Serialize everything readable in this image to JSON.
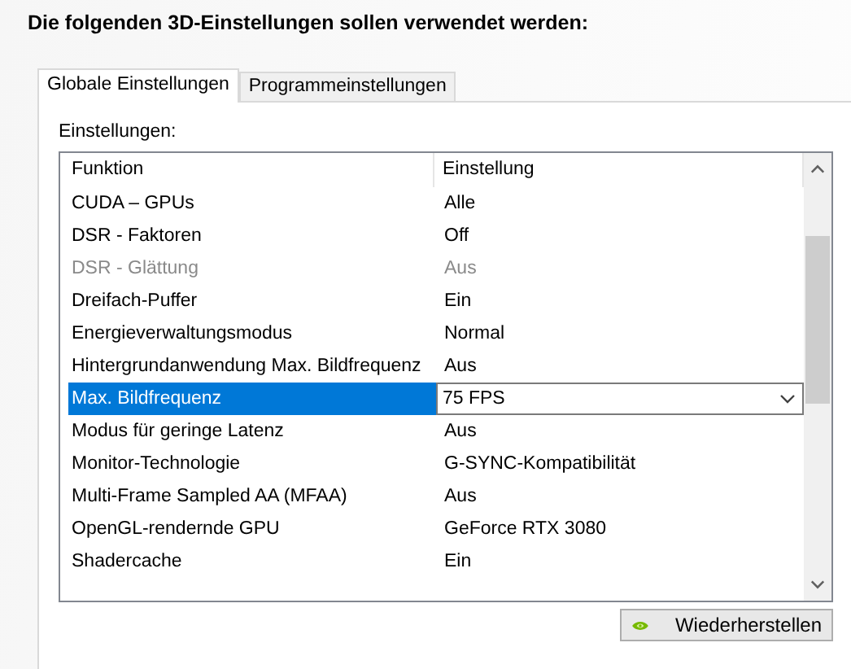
{
  "heading": "Die folgenden 3D-Einstellungen sollen verwendet werden:",
  "tabs": [
    {
      "label": "Globale Einstellungen",
      "selected": true
    },
    {
      "label": "Programmeinstellungen",
      "selected": false
    }
  ],
  "settings_label": "Einstellungen:",
  "table": {
    "columns": [
      "Funktion",
      "Einstellung"
    ],
    "rows": [
      {
        "function": "CUDA – GPUs",
        "value": "Alle",
        "disabled": false,
        "selected": false
      },
      {
        "function": "DSR - Faktoren",
        "value": "Off",
        "disabled": false,
        "selected": false
      },
      {
        "function": "DSR - Glättung",
        "value": "Aus",
        "disabled": true,
        "selected": false
      },
      {
        "function": "Dreifach-Puffer",
        "value": "Ein",
        "disabled": false,
        "selected": false
      },
      {
        "function": "Energieverwaltungsmodus",
        "value": "Normal",
        "disabled": false,
        "selected": false
      },
      {
        "function": "Hintergrundanwendung Max. Bildfrequenz",
        "value": "Aus",
        "disabled": false,
        "selected": false
      },
      {
        "function": "Max. Bildfrequenz",
        "value": "75 FPS",
        "disabled": false,
        "selected": true
      },
      {
        "function": "Modus für geringe Latenz",
        "value": "Aus",
        "disabled": false,
        "selected": false
      },
      {
        "function": "Monitor-Technologie",
        "value": "G-SYNC-Kompatibilität",
        "disabled": false,
        "selected": false
      },
      {
        "function": "Multi-Frame Sampled AA (MFAA)",
        "value": "Aus",
        "disabled": false,
        "selected": false
      },
      {
        "function": "OpenGL-rendernde GPU",
        "value": "GeForce RTX 3080",
        "disabled": false,
        "selected": false
      },
      {
        "function": "Shadercache",
        "value": "Ein",
        "disabled": false,
        "selected": false
      }
    ]
  },
  "restore_button": "Wiederherstellen"
}
